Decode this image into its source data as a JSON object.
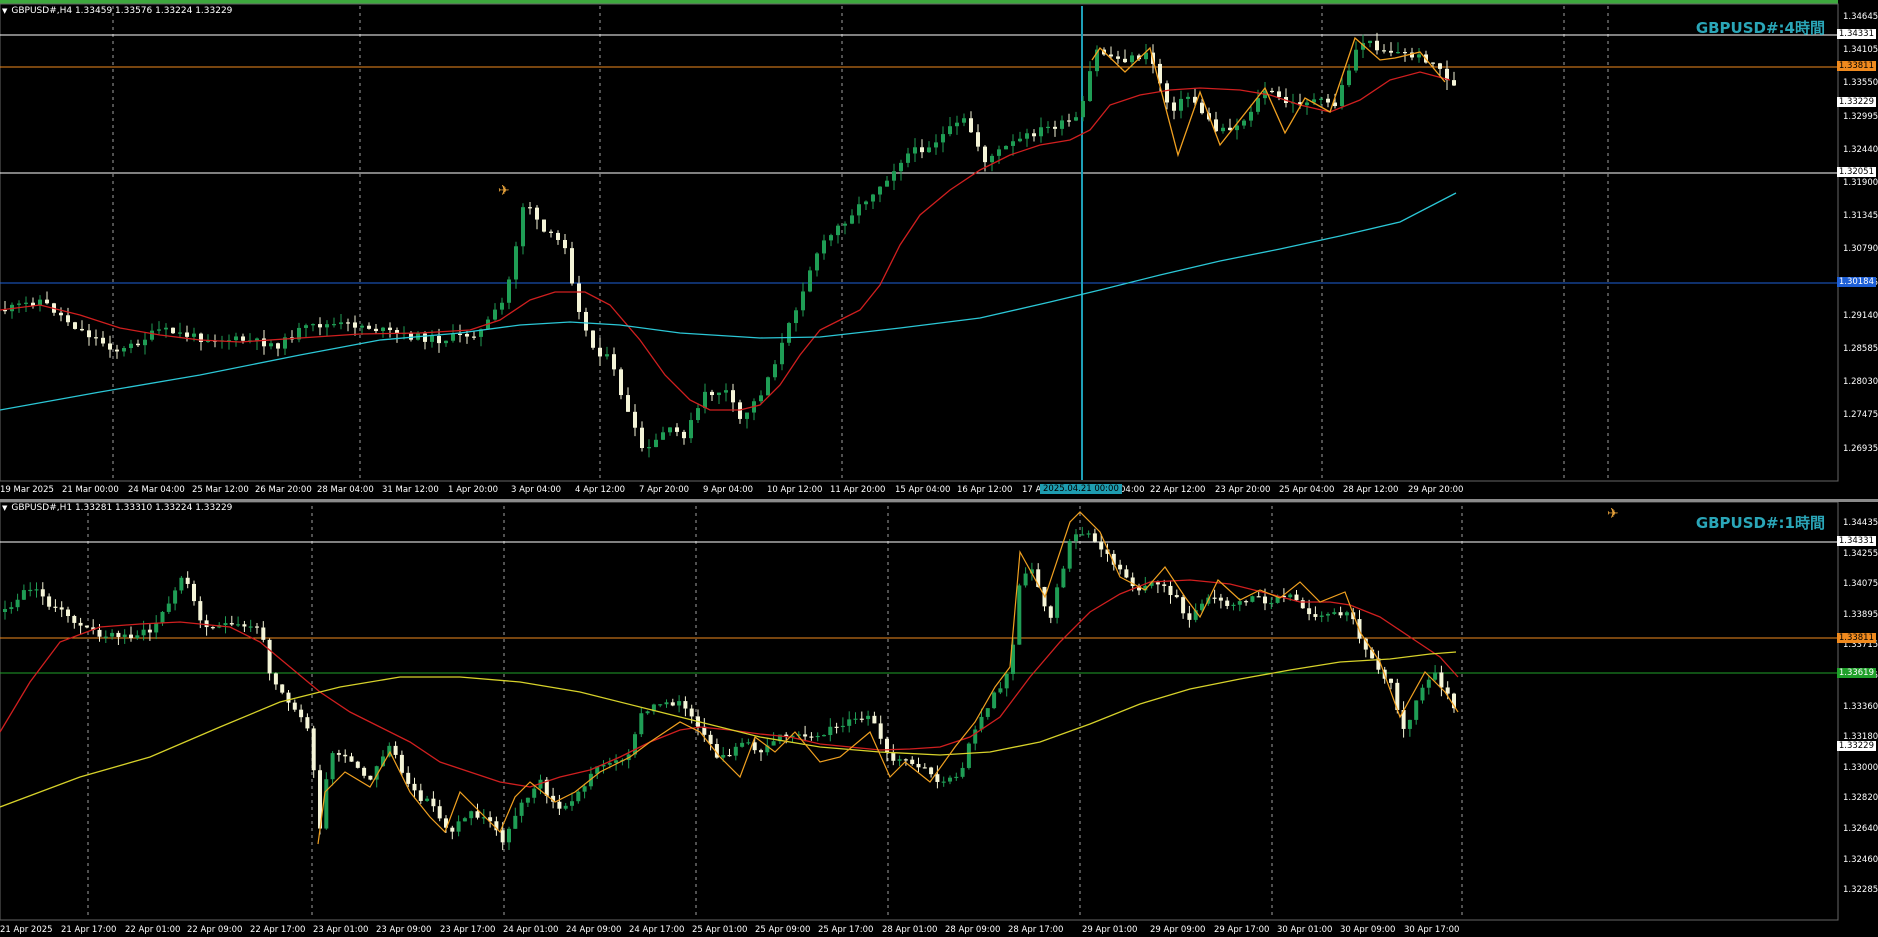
{
  "colors": {
    "background": "#000000",
    "bull_candle": "#1f9d55",
    "bear_candle": "#f5f5d8",
    "ma_red": "#d01f1f",
    "ma_cyan": "#2bc7d6",
    "ma_yellow": "#d6d12a",
    "zigzag": "#f0a020",
    "level_orange": "#f08a1e",
    "level_white": "#ffffff",
    "level_blue": "#1e5fd6",
    "level_green": "#1fa02a",
    "crosshair": "#1ea0b8",
    "top_bar": "#3ea83e",
    "grid": "#a0a0a0"
  },
  "icons": {
    "signal": "satellite-icon",
    "collapse": "triangle-down-icon"
  },
  "top_chart": {
    "header": "GBPUSD#,H4  1.33459 1.33576 1.33224 1.33229",
    "title": "GBPUSD#:4時間",
    "price_labels": [
      "1.34645",
      "1.34105",
      "1.33550",
      "1.32995",
      "1.32440",
      "1.31900",
      "1.31345",
      "1.30790",
      "1.29695",
      "1.29140",
      "1.28585",
      "1.28030",
      "1.27475",
      "1.26935"
    ],
    "level_tags": {
      "white_upper": "1.34331",
      "orange": "1.33811",
      "current": "1.33229",
      "white_lower": "1.32051",
      "blue": "1.30184"
    },
    "time_labels": [
      "19 Mar 2025",
      "21 Mar 00:00",
      "24 Mar 04:00",
      "25 Mar 12:00",
      "26 Mar 20:00",
      "28 Mar 04:00",
      "31 Mar 12:00",
      "1 Apr 20:00",
      "3 Apr 04:00",
      "4 Apr 12:00",
      "7 Apr 20:00",
      "9 Apr 04:00",
      "10 Apr 12:00",
      "11 Apr 20:00",
      "15 Apr 04:00",
      "16 Apr 12:00",
      "17 A",
      "04:00",
      "22 Apr 12:00",
      "23 Apr 20:00",
      "25 Apr 04:00",
      "28 Apr 12:00",
      "29 Apr 20:00"
    ],
    "crosshair_time": "2025.04.21 00:00"
  },
  "bottom_chart": {
    "header": "GBPUSD#,H1  1.33281 1.33310 1.33224 1.33229",
    "title": "GBPUSD#:1時間",
    "price_labels": [
      "1.34435",
      "1.34255",
      "1.34075",
      "1.33895",
      "1.33715",
      "1.33535",
      "1.33360",
      "1.33180",
      "1.33000",
      "1.32820",
      "1.32640",
      "1.32460",
      "1.32285"
    ],
    "level_tags": {
      "white": "1.34331",
      "orange": "1.33811",
      "green": "1.33619",
      "current": "1.33229"
    },
    "time_labels": [
      "21 Apr 2025",
      "21 Apr 17:00",
      "22 Apr 01:00",
      "22 Apr 09:00",
      "22 Apr 17:00",
      "23 Apr 01:00",
      "23 Apr 09:00",
      "23 Apr 17:00",
      "24 Apr 01:00",
      "24 Apr 09:00",
      "24 Apr 17:00",
      "25 Apr 01:00",
      "25 Apr 09:00",
      "25 Apr 17:00",
      "28 Apr 01:00",
      "28 Apr 09:00",
      "28 Apr 17:00",
      "29 Apr 01:00",
      "29 Apr 09:00",
      "29 Apr 17:00",
      "30 Apr 01:00",
      "30 Apr 09:00",
      "30 Apr 17:00"
    ]
  }
}
